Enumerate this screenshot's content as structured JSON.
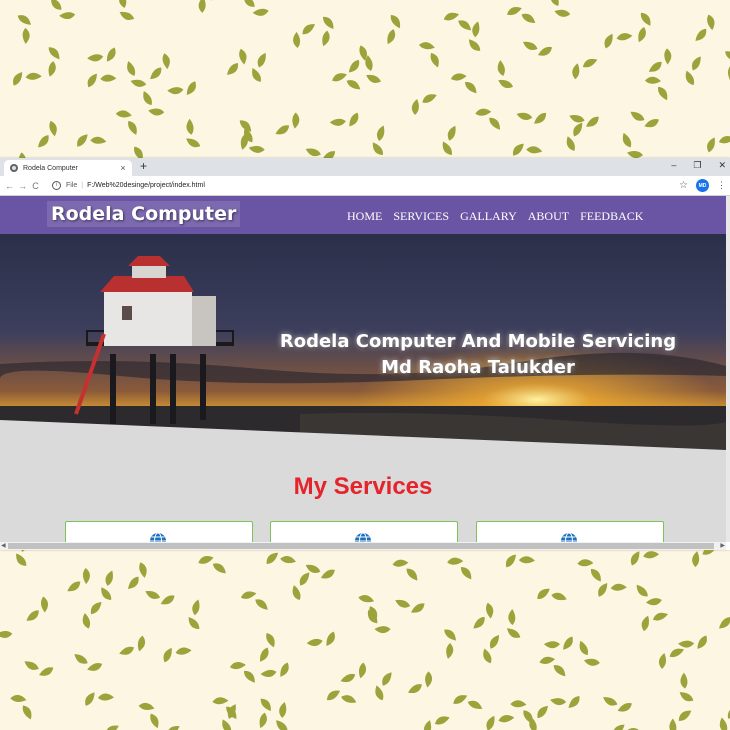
{
  "browser": {
    "tab_title": "Rodela Computer",
    "tab_close": "×",
    "new_tab": "+",
    "minimize": "–",
    "restore": "❐",
    "close": "✕",
    "back": "←",
    "forward": "→",
    "reload": "C",
    "info": "i",
    "file_label": "File",
    "url_sep": "|",
    "url": "F:/Web%20desinge/project/index.html",
    "star": "☆",
    "profile": "MD",
    "menu": "⋮"
  },
  "site": {
    "logo": "Rodela Computer",
    "nav": [
      "HOME",
      "SERVICES",
      "GALLARY",
      "ABOUT",
      "FEEDBACK"
    ],
    "hero_line1": "Rodela Computer And Mobile Servicing",
    "hero_line2": "Md Raoha Talukder",
    "services_title": "My Services",
    "card_icon": "globe-icon"
  },
  "colors": {
    "header": "#6a55a4",
    "services_title": "#e4232b",
    "card_border": "#7cc35a",
    "leaf": "#9aa43a",
    "background": "#fdf6e3"
  }
}
